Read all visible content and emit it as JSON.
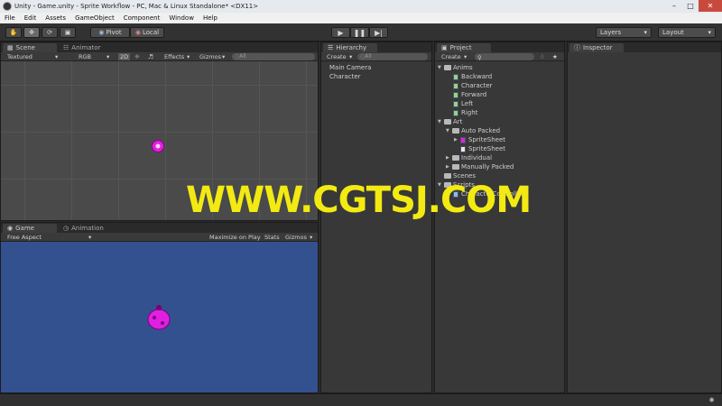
{
  "window": {
    "title": "Unity - Game.unity - Sprite Workflow - PC, Mac & Linux Standalone* <DX11>",
    "icons": {
      "app": "unity-logo-icon",
      "minimize": "minimize-icon",
      "maximize": "maximize-icon",
      "close": "close-icon"
    }
  },
  "menu": [
    "File",
    "Edit",
    "Assets",
    "GameObject",
    "Component",
    "Window",
    "Help"
  ],
  "toolbar": {
    "tools": [
      "hand-icon",
      "move-icon",
      "rotate-icon",
      "scale-icon"
    ],
    "pivot_label": "Pivot",
    "local_label": "Local",
    "play_icons": [
      "play-icon",
      "pause-icon",
      "step-icon"
    ],
    "layers_label": "Layers",
    "layout_label": "Layout"
  },
  "scene_panel": {
    "tabs": [
      "Scene",
      "Animator"
    ],
    "subbar": {
      "shading": "Textured",
      "render_mode": "RGB",
      "mode_2d": "2D",
      "effects": "Effects",
      "gizmos": "Gizmos",
      "search_placeholder": "◌All"
    }
  },
  "game_panel": {
    "tabs": [
      "Game",
      "Animation"
    ],
    "subbar": {
      "aspect": "Free Aspect",
      "maximize": "Maximize on Play",
      "stats": "Stats",
      "gizmos": "Gizmos"
    }
  },
  "hierarchy": {
    "tab": "Hierarchy",
    "create": "Create",
    "search_placeholder": "◌All",
    "items": [
      "Main Camera",
      "Character"
    ]
  },
  "project": {
    "tab": "Project",
    "create": "Create",
    "items": {
      "anims": "Anims",
      "backward": "Backward",
      "character": "Character",
      "forward": "Forward",
      "left": "Left",
      "right": "Right",
      "art": "Art",
      "auto_packed": "Auto Packed",
      "spritesheet_1": "SpriteSheet",
      "spritesheet_2": "SpriteSheet",
      "individual": "Individual",
      "manually_packed": "Manually Packed",
      "scenes": "Scenes",
      "scripts": "Scripts",
      "controller": "CharacterController"
    }
  },
  "inspector": {
    "tab": "Inspector"
  },
  "watermark": "WWW.CGTSJ.COM",
  "colors": {
    "sprite": "#e020e0",
    "game_bg": "#33518f",
    "watermark": "#f2ea12"
  }
}
